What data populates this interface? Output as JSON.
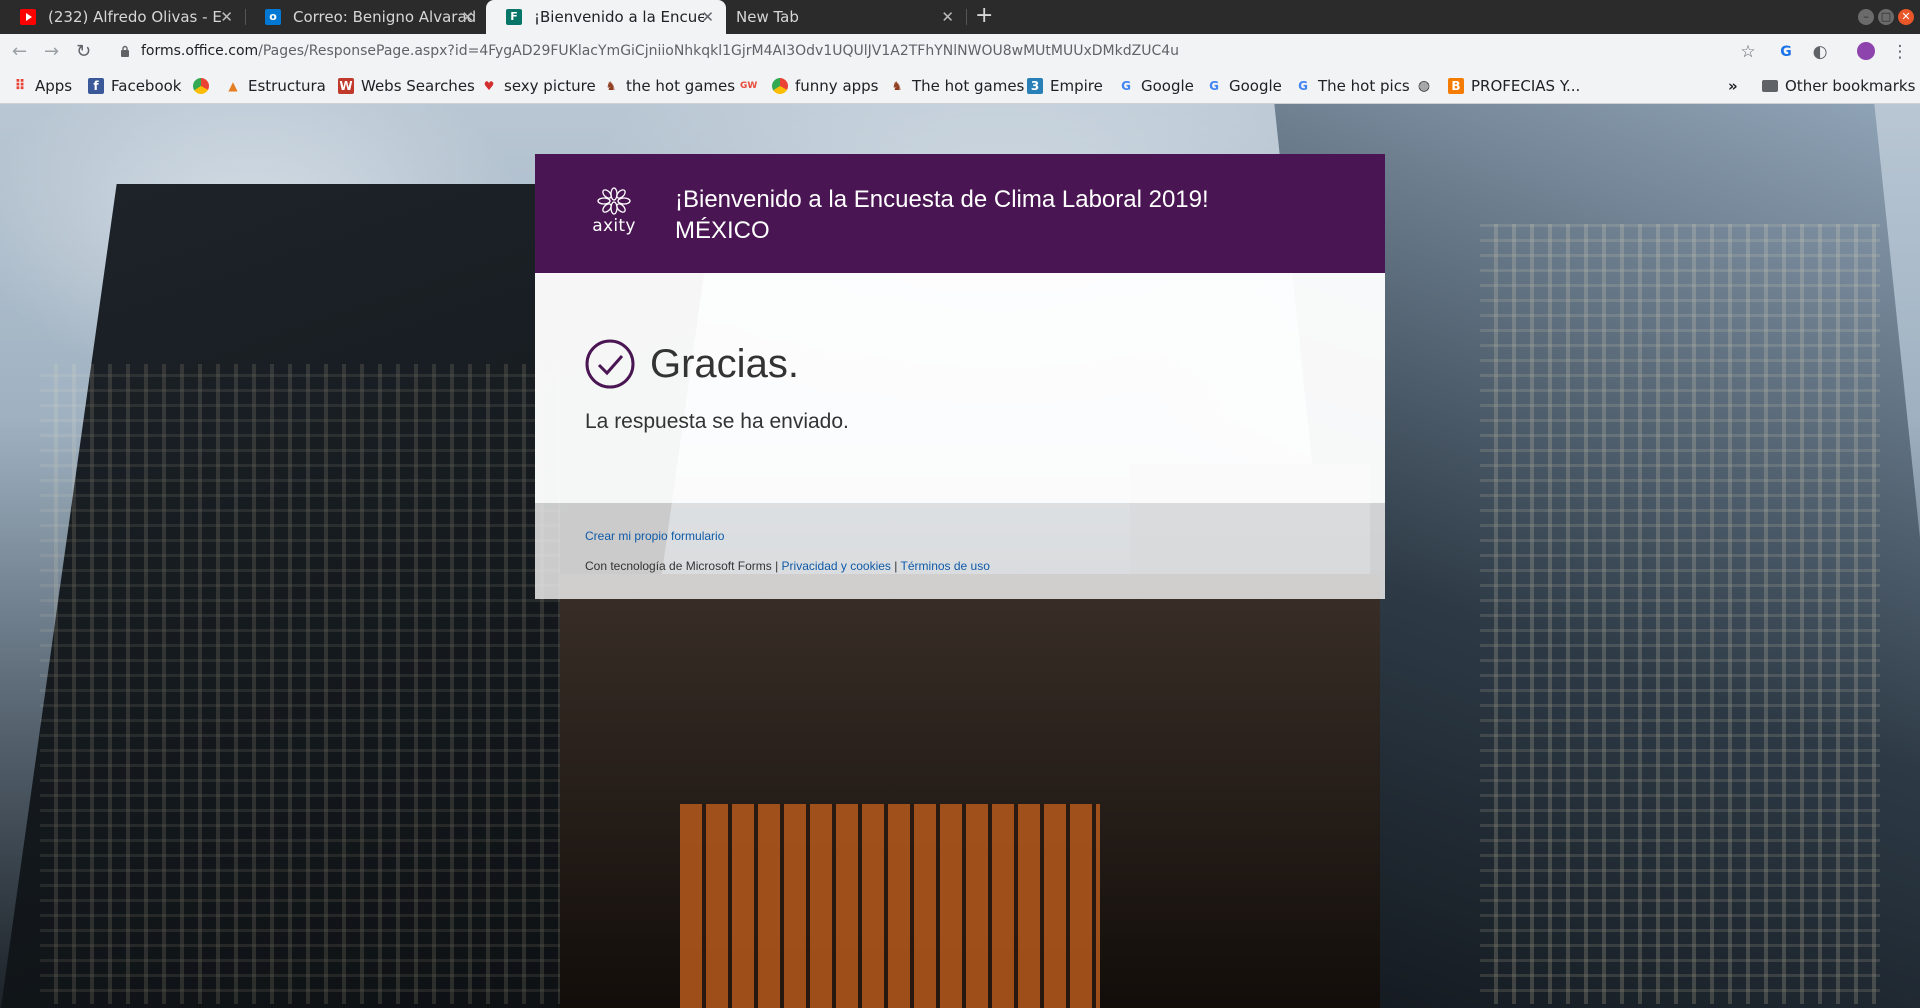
{
  "browser": {
    "tabs": [
      {
        "title": "(232) Alfredo Olivas - E",
        "favicon": "youtube-icon",
        "favicon_color": "#ff0000",
        "active": false
      },
      {
        "title": "Correo: Benigno Alvarado",
        "favicon": "outlook-icon",
        "favicon_color": "#0078d4",
        "active": false
      },
      {
        "title": "¡Bienvenido a la Encuesta",
        "favicon": "forms-icon",
        "favicon_color": "#077568",
        "active": true
      },
      {
        "title": "New Tab",
        "favicon": "",
        "active": false
      }
    ],
    "address": {
      "host": "forms.office.com",
      "path": "/Pages/ResponsePage.aspx?id=4FygAD29FUKlacYmGiCjniioNhkqkl1GjrM4AI3Odv1UQUlJV1A2TFhYNlNWOU8wMUtMUUxDMkdZUC4u"
    },
    "bookmarks": [
      {
        "label": "Apps",
        "icon": "apps-grid-icon"
      },
      {
        "label": "Facebook",
        "icon": "facebook-icon"
      },
      {
        "label": "",
        "icon": "chrome-icon"
      },
      {
        "label": "Estructura",
        "icon": "pma-icon"
      },
      {
        "label": "Webs Searches",
        "icon": "w-icon"
      },
      {
        "label": "sexy picture",
        "icon": "pin-icon"
      },
      {
        "label": "the hot games",
        "icon": "game-icon"
      },
      {
        "label": "",
        "icon": "gw-icon"
      },
      {
        "label": "funny apps",
        "icon": "chrome-icon"
      },
      {
        "label": "The hot games",
        "icon": "game-icon"
      },
      {
        "label": "Empire",
        "icon": "empire-icon"
      },
      {
        "label": "Google",
        "icon": "google-icon"
      },
      {
        "label": "Google",
        "icon": "google-icon"
      },
      {
        "label": "The hot pics",
        "icon": "google-icon"
      },
      {
        "label": "",
        "icon": "globe-icon"
      },
      {
        "label": "PROFECIAS Y...",
        "icon": "blogger-icon"
      }
    ],
    "overflow_label": "»",
    "other_bookmarks": "Other bookmarks"
  },
  "form": {
    "brand": "axity",
    "title_line1": "¡Bienvenido a la Encuesta de Clima Laboral 2019!",
    "title_line2": "MÉXICO",
    "thanks": "Gracias.",
    "sent_message": "La respuesta se ha enviado.",
    "create_link": "Crear mi propio formulario",
    "powered_by": "Con tecnología de Microsoft Forms |",
    "privacy_link": "Privacidad y cookies",
    "separator": "|",
    "terms_link": "Términos de uso",
    "header_color": "#4a1553",
    "link_color": "#0f5aa8"
  }
}
